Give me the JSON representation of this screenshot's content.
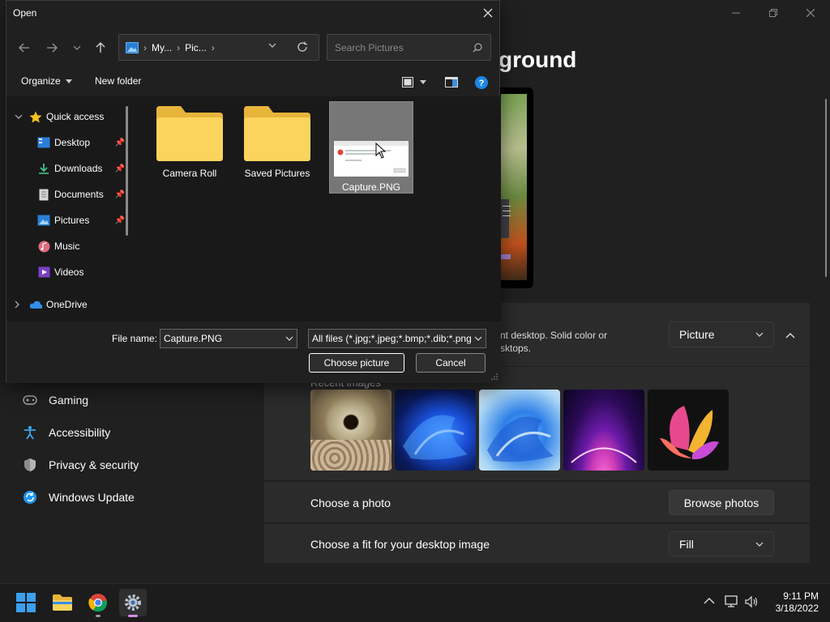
{
  "settings": {
    "title_partial": "ground",
    "bg_description": "nt desktop. Solid color or\nsktops.",
    "bg_type_value": "Picture",
    "recent_images_label": "Recent images",
    "choose_photo_label": "Choose a photo",
    "browse_photos_label": "Browse photos",
    "fit_label": "Choose a fit for your desktop image",
    "fit_value": "Fill",
    "nav": [
      {
        "label": "Gaming",
        "icon": "gamepad-icon"
      },
      {
        "label": "Accessibility",
        "icon": "accessibility-icon"
      },
      {
        "label": "Privacy & security",
        "icon": "shield-icon"
      },
      {
        "label": "Windows Update",
        "icon": "update-icon"
      }
    ]
  },
  "dialog": {
    "title": "Open",
    "breadcrumb": [
      "My...",
      "Pic...",
      ""
    ],
    "search_placeholder": "Search Pictures",
    "organize_label": "Organize",
    "new_folder_label": "New folder",
    "tree": [
      {
        "label": "Quick access",
        "icon": "star-icon",
        "pinned": false
      },
      {
        "label": "Desktop",
        "icon": "desktop-icon",
        "pinned": true
      },
      {
        "label": "Downloads",
        "icon": "download-icon",
        "pinned": true
      },
      {
        "label": "Documents",
        "icon": "document-icon",
        "pinned": true
      },
      {
        "label": "Pictures",
        "icon": "picture-icon",
        "pinned": true
      },
      {
        "label": "Music",
        "icon": "music-icon",
        "pinned": false
      },
      {
        "label": "Videos",
        "icon": "video-icon",
        "pinned": false
      },
      {
        "label": "OneDrive",
        "icon": "cloud-icon",
        "pinned": false
      }
    ],
    "files": [
      {
        "name": "Camera Roll",
        "type": "folder"
      },
      {
        "name": "Saved Pictures",
        "type": "folder"
      },
      {
        "name": "Capture.PNG",
        "type": "image",
        "selected": true
      }
    ],
    "file_name_label": "File name:",
    "file_name_value": "Capture.PNG",
    "file_type_value": "All files (*.jpg;*.jpeg;*.bmp;*.dib;*.png",
    "ok_label": "Choose picture",
    "cancel_label": "Cancel"
  },
  "taskbar": {
    "time": "9:11 PM",
    "date": "3/18/2022"
  },
  "colors": {
    "accent": "#0078d4",
    "folder": "#f3c84a",
    "background": "#202020"
  }
}
